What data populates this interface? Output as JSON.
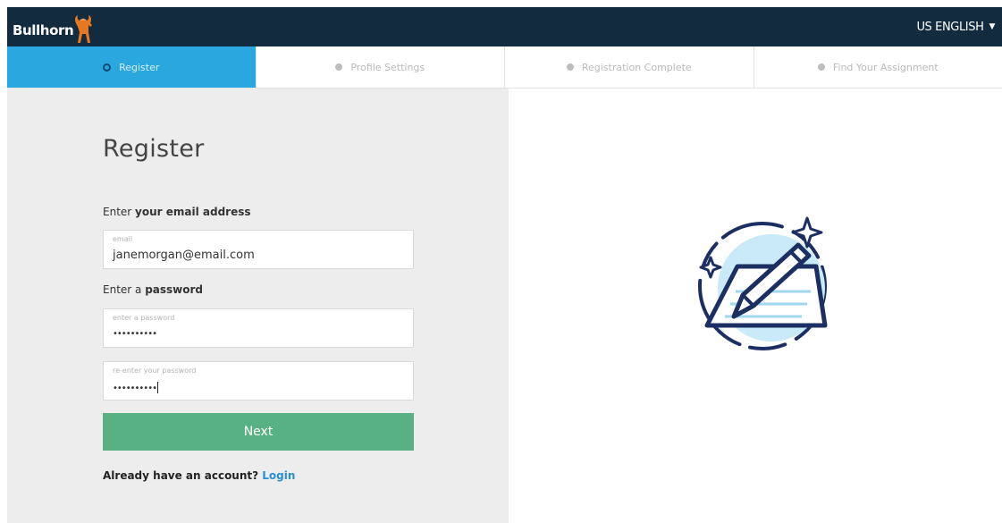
{
  "header": {
    "logo_text": "Bullhorn",
    "language": "US ENGLISH"
  },
  "steps": [
    {
      "label": "Register",
      "active": true
    },
    {
      "label": "Profile Settings",
      "active": false
    },
    {
      "label": "Registration Complete",
      "active": false
    },
    {
      "label": "Find Your Assignment",
      "active": false
    }
  ],
  "form": {
    "title": "Register",
    "email_label_prefix": "Enter ",
    "email_label_bold": "your email address",
    "email_placeholder": "email",
    "email_value": "janemorgan@email.com",
    "password_label_prefix": "Enter a ",
    "password_label_bold": "password",
    "password_placeholder": "enter a password",
    "password_value": "••••••••••",
    "confirm_placeholder": "re-enter your password",
    "confirm_value": "••••••••••",
    "next_label": "Next",
    "account_prompt": "Already have an account?",
    "login_label": "Login"
  },
  "colors": {
    "header_bg": "#132b3f",
    "active_step": "#2aa7de",
    "next_button": "#58b183",
    "link": "#2a8fd0",
    "illustration_navy": "#1c2f63",
    "illustration_light": "#c9eaf8"
  },
  "icons": {
    "logo": "bull-icon",
    "illustration": "edit-document-sparkle-icon"
  }
}
